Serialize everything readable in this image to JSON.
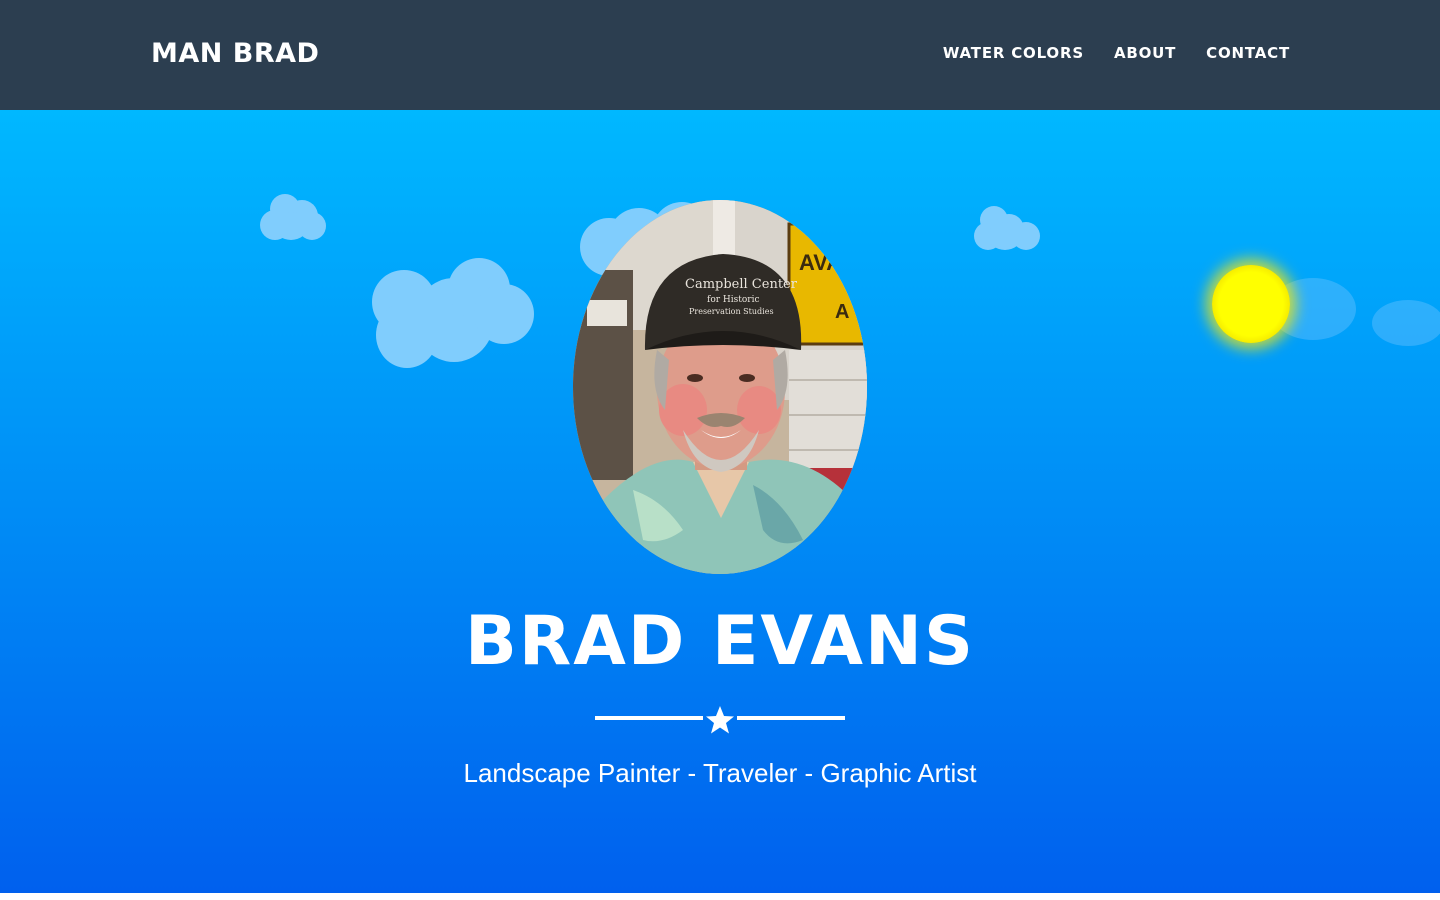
{
  "navbar": {
    "brand": "MAN BRAD",
    "links": [
      {
        "label": "WATER COLORS"
      },
      {
        "label": "ABOUT"
      },
      {
        "label": "CONTACT"
      }
    ]
  },
  "hero": {
    "name": "BRAD EVANS",
    "tagline": "Landscape Painter - Traveler - Graphic Artist",
    "divider_icon": "star-icon",
    "portrait_hat_text": [
      "Campbell Center",
      "for Historic",
      "Preservation Studies"
    ],
    "portrait_sign_text": [
      "AVA",
      "A"
    ]
  },
  "decorations": {
    "sun_icon": "sun-icon",
    "cloud_icon": "cloud-icon"
  },
  "colors": {
    "navbar": "#2c3e50",
    "hero_top": "#00b8ff",
    "hero_bottom": "#0060ee",
    "cloud": "#80cdfd",
    "sun": "#ffff00",
    "text": "#ffffff"
  }
}
